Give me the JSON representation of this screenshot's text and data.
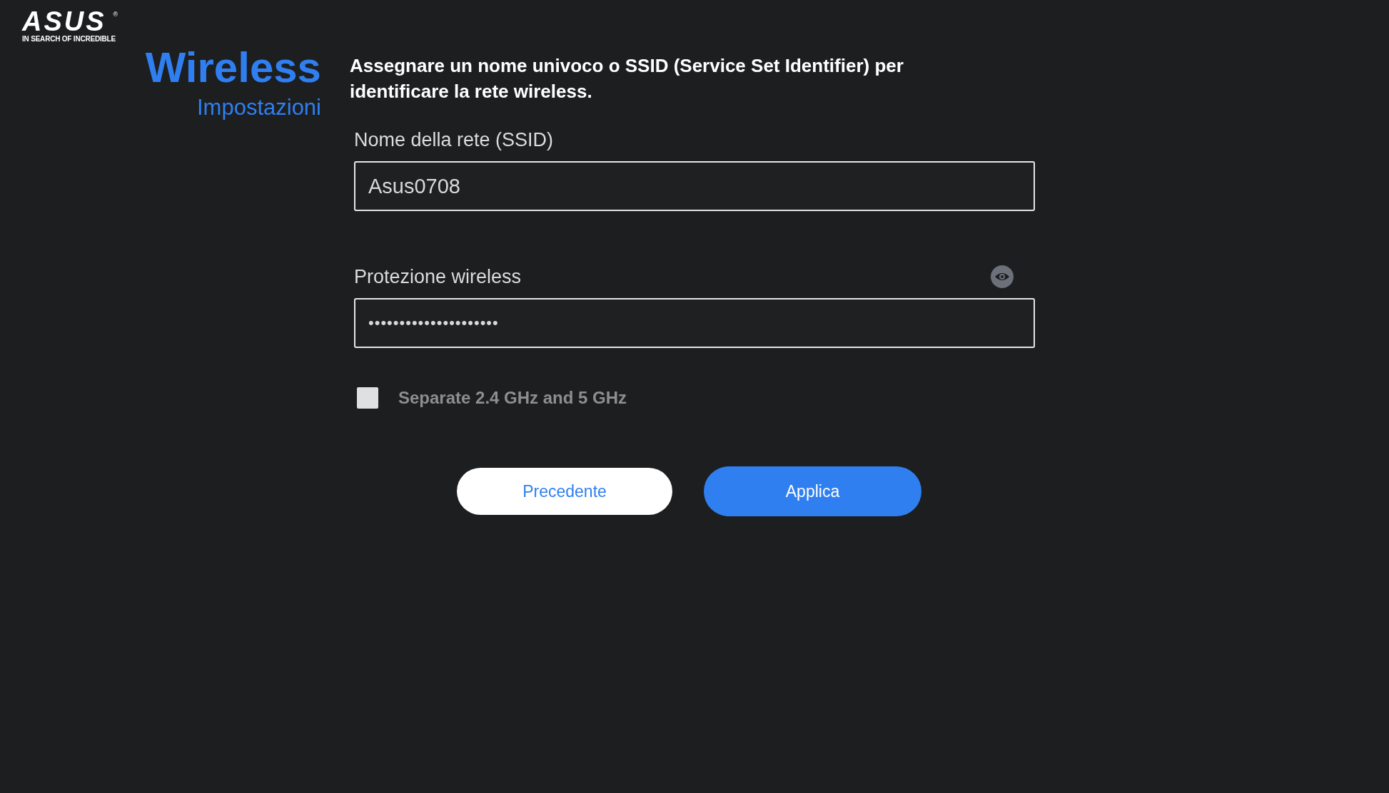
{
  "logo": {
    "wordmark": "ASUS",
    "registered": "®",
    "tagline": "IN SEARCH OF INCREDIBLE"
  },
  "heading": {
    "title": "Wireless",
    "subtitle": "Impostazioni"
  },
  "description": "Assegnare un nome univoco o SSID (Service Set Identifier) per identificare la rete wireless.",
  "fields": [
    {
      "kind": "text",
      "label": "Nome della rete (SSID)",
      "value": "Asus0708"
    },
    {
      "kind": "password",
      "label": "Protezione wireless",
      "value": "•••••••••••••••••••••"
    }
  ],
  "separate_bands": {
    "label": "Separate 2.4 GHz and 5 GHz",
    "checked": false
  },
  "buttons": [
    {
      "label": "Precedente",
      "kind": "secondary"
    },
    {
      "label": "Applica",
      "kind": "primary"
    }
  ]
}
